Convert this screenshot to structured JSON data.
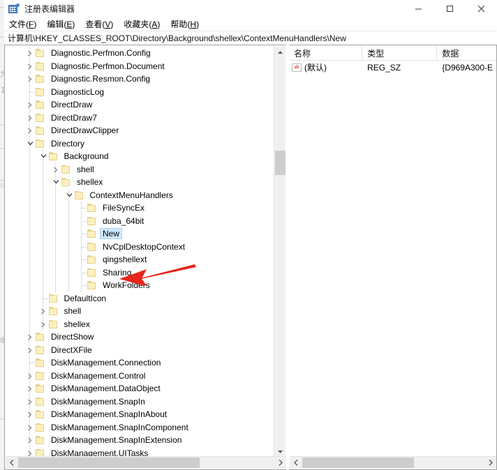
{
  "window": {
    "title": "注册表编辑器",
    "app_icon": "registry-icon",
    "minimize_label": "─",
    "maximize_label": "□",
    "close_label": "✕"
  },
  "menubar": {
    "items": [
      {
        "text": "文件",
        "mnemonic": "F"
      },
      {
        "text": "编辑",
        "mnemonic": "E"
      },
      {
        "text": "查看",
        "mnemonic": "V"
      },
      {
        "text": "收藏夹",
        "mnemonic": "A"
      },
      {
        "text": "帮助",
        "mnemonic": "H"
      }
    ]
  },
  "address": {
    "path": "计算机\\HKEY_CLASSES_ROOT\\Directory\\Background\\shellex\\ContextMenuHandlers\\New"
  },
  "tree": {
    "nodes": [
      {
        "label": "Diagnostic.Perfmon.Config",
        "depth": 1,
        "state": "collapsed",
        "selected": false
      },
      {
        "label": "Diagnostic.Perfmon.Document",
        "depth": 1,
        "state": "collapsed",
        "selected": false
      },
      {
        "label": "Diagnostic.Resmon.Config",
        "depth": 1,
        "state": "collapsed",
        "selected": false
      },
      {
        "label": "DiagnosticLog",
        "depth": 1,
        "state": "leaf",
        "selected": false
      },
      {
        "label": "DirectDraw",
        "depth": 1,
        "state": "collapsed",
        "selected": false
      },
      {
        "label": "DirectDraw7",
        "depth": 1,
        "state": "collapsed",
        "selected": false
      },
      {
        "label": "DirectDrawClipper",
        "depth": 1,
        "state": "collapsed",
        "selected": false
      },
      {
        "label": "Directory",
        "depth": 1,
        "state": "expanded",
        "selected": false
      },
      {
        "label": "Background",
        "depth": 2,
        "state": "expanded",
        "selected": false
      },
      {
        "label": "shell",
        "depth": 3,
        "state": "collapsed",
        "selected": false
      },
      {
        "label": "shellex",
        "depth": 3,
        "state": "expanded",
        "selected": false
      },
      {
        "label": "ContextMenuHandlers",
        "depth": 4,
        "state": "expanded",
        "selected": false
      },
      {
        "label": "FileSyncEx",
        "depth": 5,
        "state": "leaf",
        "selected": false
      },
      {
        "label": "duba_64bit",
        "depth": 5,
        "state": "leaf",
        "selected": false
      },
      {
        "label": "New",
        "depth": 5,
        "state": "leaf",
        "selected": true
      },
      {
        "label": "NvCplDesktopContext",
        "depth": 5,
        "state": "leaf",
        "selected": false
      },
      {
        "label": "qingshellext",
        "depth": 5,
        "state": "leaf",
        "selected": false
      },
      {
        "label": "Sharing",
        "depth": 5,
        "state": "leaf",
        "selected": false
      },
      {
        "label": "WorkFolders",
        "depth": 5,
        "state": "leaf",
        "selected": false
      },
      {
        "label": "DefaultIcon",
        "depth": 2,
        "state": "leaf",
        "selected": false
      },
      {
        "label": "shell",
        "depth": 2,
        "state": "collapsed",
        "selected": false
      },
      {
        "label": "shellex",
        "depth": 2,
        "state": "collapsed",
        "selected": false
      },
      {
        "label": "DirectShow",
        "depth": 1,
        "state": "collapsed",
        "selected": false
      },
      {
        "label": "DirectXFile",
        "depth": 1,
        "state": "collapsed",
        "selected": false
      },
      {
        "label": "DiskManagement.Connection",
        "depth": 1,
        "state": "leaf",
        "selected": false
      },
      {
        "label": "DiskManagement.Control",
        "depth": 1,
        "state": "collapsed",
        "selected": false
      },
      {
        "label": "DiskManagement.DataObject",
        "depth": 1,
        "state": "collapsed",
        "selected": false
      },
      {
        "label": "DiskManagement.SnapIn",
        "depth": 1,
        "state": "collapsed",
        "selected": false
      },
      {
        "label": "DiskManagement.SnapInAbout",
        "depth": 1,
        "state": "collapsed",
        "selected": false
      },
      {
        "label": "DiskManagement.SnapInComponent",
        "depth": 1,
        "state": "collapsed",
        "selected": false
      },
      {
        "label": "DiskManagement.SnapInExtension",
        "depth": 1,
        "state": "collapsed",
        "selected": false
      },
      {
        "label": "DiskManagement.UITasks",
        "depth": 1,
        "state": "collapsed",
        "selected": false
      }
    ]
  },
  "values": {
    "columns": [
      "名称",
      "类型",
      "数据"
    ],
    "rows": [
      {
        "icon": "string-value-icon",
        "name": "(默认)",
        "type": "REG_SZ",
        "data": "{D969A300-E"
      }
    ]
  },
  "annotation": {
    "arrow_color": "#e8251c",
    "points_to": "New"
  },
  "colors": {
    "selection": "#cde8ff",
    "folder": "#fcf0c0",
    "scrollbar_thumb": "#cdcdcd",
    "arrow_red": "#e8251c"
  }
}
